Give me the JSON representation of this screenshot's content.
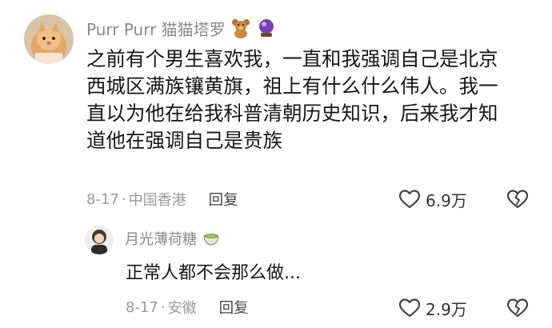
{
  "comment": {
    "username": "Purr Purr 猫猫塔罗",
    "badges": [
      "teddy-bear-icon",
      "crystal-ball-icon"
    ],
    "text_lines": [
      "之前有个男生喜欢我，一直和我强调自己是北京",
      "西城区满族镶黄旗，祖上有什么什么伟人。我一",
      "直以为他在给我科普清朝历史知识，后来我才知",
      "道他在强调自己是贵族"
    ],
    "date": "8-17",
    "location": "中国香港",
    "reply_label": "回复",
    "likes": "6.9万"
  },
  "reply": {
    "username": "月光薄荷糖",
    "badges": [
      "matcha-tea-icon"
    ],
    "text": "正常人都不会那么做...",
    "date": "8-17",
    "location": "安徽",
    "reply_label": "回复",
    "likes": "2.9万"
  },
  "colors": {
    "text": "#161616",
    "muted": "#8a8a8a",
    "icon": "#444444"
  }
}
